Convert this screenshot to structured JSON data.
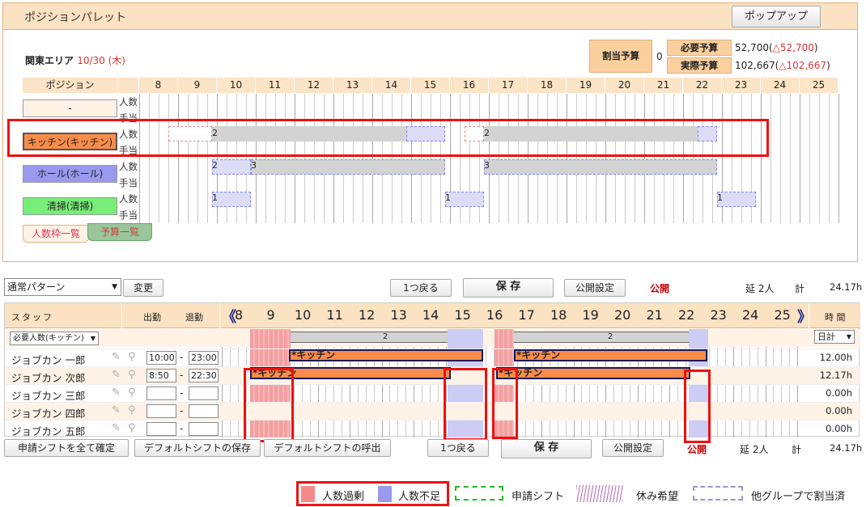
{
  "palette": {
    "title": "ポジションパレット",
    "popup_label": "ポップアップ",
    "area": "関東エリア",
    "date": "10/30 (木)",
    "budget_label": "割当予算",
    "budget_value": "0",
    "req_label": "必要予算",
    "req_value": "52,700(",
    "req_delta": "△52,700",
    "act_label": "実際予算",
    "act_value": "102,667(",
    "act_delta": "△102,667",
    "close": ")",
    "position_header": "ポジション",
    "hours": [
      "8",
      "9",
      "10",
      "11",
      "12",
      "13",
      "14",
      "15",
      "16",
      "17",
      "18",
      "19",
      "20",
      "21",
      "22",
      "23",
      "24",
      "25"
    ],
    "rows": [
      {
        "label": "-",
        "sub1": "人数",
        "sub2": "手当"
      },
      {
        "label": "キッチン(キッチン)",
        "sub1": "人数",
        "sub2": "手当"
      },
      {
        "label": "ホール(ホール)",
        "sub1": "人数",
        "sub2": "手当"
      },
      {
        "label": "清掃(清掃)",
        "sub1": "人数",
        "sub2": "手当"
      }
    ],
    "nums": {
      "k1": "2",
      "k2": "2",
      "h1": "2",
      "h2": "3",
      "h3": "3",
      "c1": "1",
      "c2": "1",
      "c3": "1"
    },
    "tab1": "人数枠一覧",
    "tab2": "予算一覧"
  },
  "toolbar": {
    "pattern": "通常パターン",
    "change": "変更",
    "back": "1つ戻る",
    "save": "保 存",
    "publish_settings": "公開設定",
    "publish": "公開",
    "total_label": "延 2人",
    "kei": "計",
    "total_hours": "24.17h"
  },
  "schedule": {
    "staff_header": "スタッフ",
    "in_header": "出勤",
    "out_header": "退勤",
    "time_header": "時 間",
    "hours": [
      "8",
      "9",
      "10",
      "11",
      "12",
      "13",
      "14",
      "15",
      "16",
      "17",
      "18",
      "19",
      "20",
      "21",
      "22",
      "23",
      "24",
      "25"
    ],
    "need_select": "必要人数(キッチン)",
    "daily": "日計",
    "need1": "2",
    "need2": "2",
    "staff": [
      {
        "name": "ジョブカン 一郎",
        "in": "10:00",
        "out": "23:00",
        "hours": "12.00h",
        "bar": "*キッチン"
      },
      {
        "name": "ジョブカン 次郎",
        "in": "8:50",
        "out": "22:30",
        "hours": "12.17h",
        "bar": "*キッチン"
      },
      {
        "name": "ジョブカン 三郎",
        "in": "",
        "out": "",
        "hours": "0.00h"
      },
      {
        "name": "ジョブカン 四郎",
        "in": "",
        "out": "",
        "hours": "0.00h"
      },
      {
        "name": "ジョブカン 五郎",
        "in": "",
        "out": "",
        "hours": "0.00h"
      }
    ],
    "dash": "-"
  },
  "bottom": {
    "confirm_all": "申請シフトを全て確定",
    "save_default": "デフォルトシフトの保存",
    "load_default": "デフォルトシフトの呼出",
    "back": "1つ戻る",
    "save": "保 存",
    "publish_settings": "公開設定",
    "publish": "公開",
    "total_label": "延 2人",
    "kei": "計",
    "total_hours": "24.17h"
  },
  "legend": {
    "over": "人数過剰",
    "short": "人数不足",
    "request": "申請シフト",
    "rest": "休み希望",
    "other": "他グループで割当済"
  },
  "colors": {
    "over": "#f48a8a",
    "short": "#9999ee",
    "request": "#22bb22",
    "accent": "#e11111"
  }
}
